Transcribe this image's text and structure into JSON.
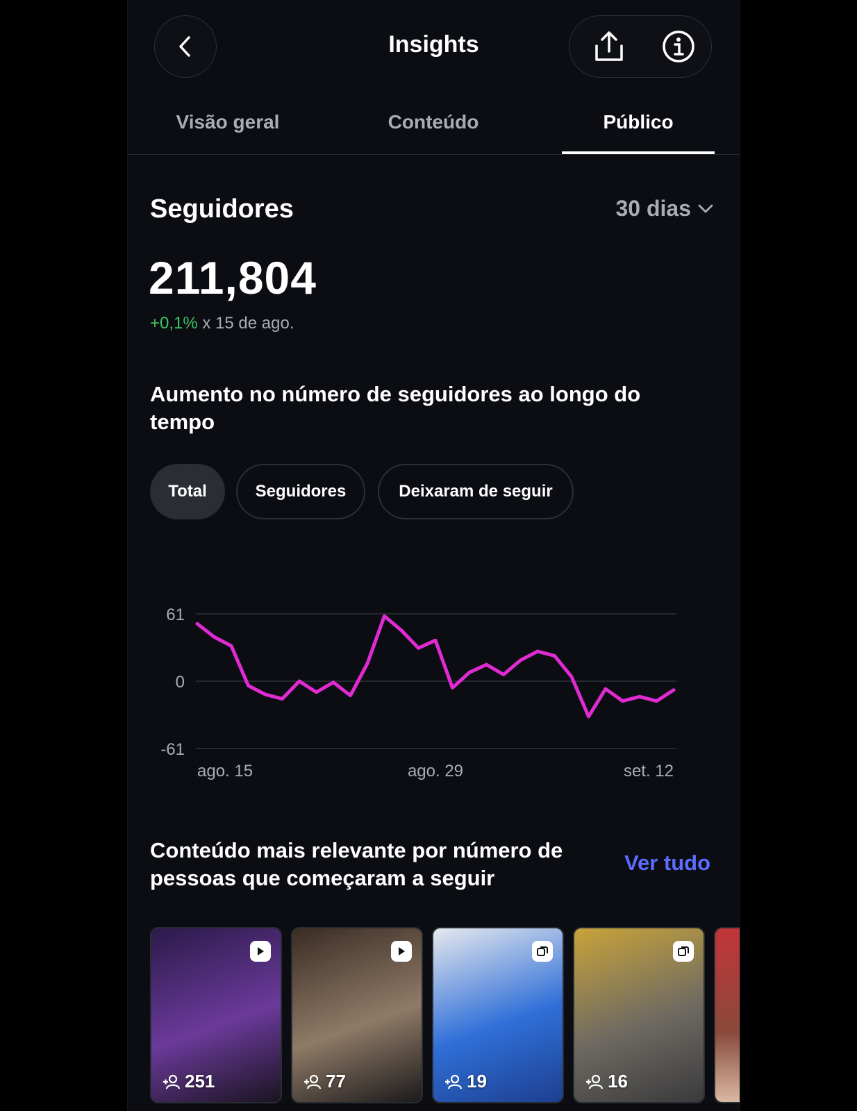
{
  "header": {
    "title": "Insights",
    "back_icon": "chevron-left-icon",
    "share_icon": "share-icon",
    "info_icon": "info-icon"
  },
  "tabs": [
    {
      "label": "Visão geral"
    },
    {
      "label": "Conteúdo"
    },
    {
      "label": "Público",
      "active": true
    }
  ],
  "followers": {
    "title": "Seguidores",
    "period": "30 dias",
    "count": "211,804",
    "delta_value": "+0,1%",
    "delta_text": " x 15 de ago."
  },
  "growth": {
    "title": "Aumento no número de seguidores ao longo do tempo",
    "filters": [
      {
        "label": "Total",
        "selected": true
      },
      {
        "label": "Seguidores"
      },
      {
        "label": "Deixaram de seguir"
      }
    ]
  },
  "chart_data": {
    "type": "line",
    "series": [
      {
        "values": [
          52,
          40,
          32,
          -4,
          -12,
          -16,
          0,
          -10,
          -1,
          -13,
          16,
          59,
          46,
          30,
          37,
          -6,
          8,
          15,
          6,
          19,
          27,
          23,
          4,
          -32,
          -7,
          -18,
          -14,
          -18,
          -8
        ]
      }
    ],
    "x_tick_labels": [
      {
        "label": "ago. 15",
        "index": 0
      },
      {
        "label": "ago. 29",
        "index": 14
      },
      {
        "label": "set. 12",
        "index": 28
      }
    ],
    "y_ticks": [
      "61",
      "0",
      "-61"
    ],
    "ylim": [
      -61,
      61
    ],
    "grid": true,
    "line_color": "#e02bd3"
  },
  "content": {
    "title": "Conteúdo mais relevante por número de pessoas que começaram a seguir",
    "see_all": "Ver tudo",
    "items": [
      {
        "followers": "251",
        "badge": "play-icon",
        "colors": [
          "#2b1a4a",
          "#6b3a9a",
          "#1a1420"
        ]
      },
      {
        "followers": "77",
        "badge": "play-icon",
        "colors": [
          "#3a2c24",
          "#8f7a66",
          "#1b1a1c"
        ]
      },
      {
        "followers": "19",
        "badge": "carousel-icon",
        "colors": [
          "#e6e8ee",
          "#2f6fd8",
          "#1d3f8f"
        ]
      },
      {
        "followers": "16",
        "badge": "carousel-icon",
        "colors": [
          "#c8a33a",
          "#6e6a62",
          "#3a3a3c"
        ]
      }
    ]
  }
}
